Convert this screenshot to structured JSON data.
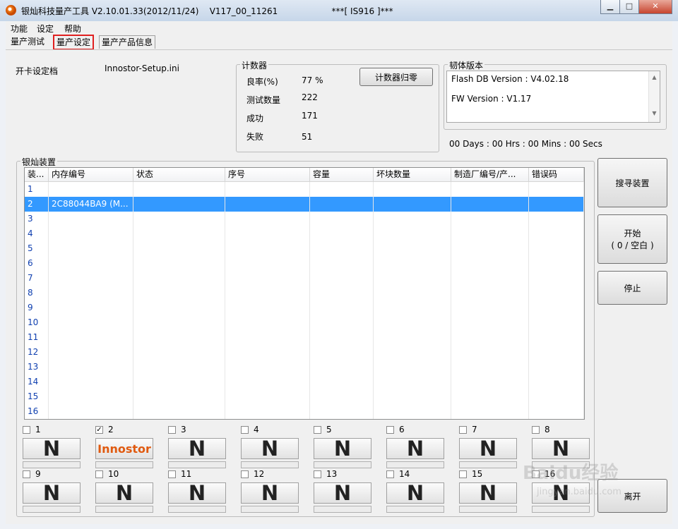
{
  "window": {
    "title": "银灿科技量产工具 V2.10.01.33(2012/11/24)    V117_00_11261                    ***[ IS916 ]***",
    "controls": {
      "minimize": "▁",
      "maximize": "□",
      "close": "✕"
    }
  },
  "menu": [
    "功能",
    "设定",
    "帮助"
  ],
  "tabs": [
    "量产测试",
    "量产设定",
    "量产产品信息"
  ],
  "settings": {
    "label": "开卡设定档",
    "value": "Innostor-Setup.ini"
  },
  "counter": {
    "title": "计数器",
    "reset_label": "计数器归零",
    "rows": [
      {
        "label": "良率(%)",
        "value": "77 %"
      },
      {
        "label": "测试数量",
        "value": "222"
      },
      {
        "label": "成功",
        "value": "171"
      },
      {
        "label": "失败",
        "value": "51"
      }
    ]
  },
  "firmware": {
    "title": "韧体版本",
    "flash_db": "Flash DB Version :  V4.02.18",
    "fw": "FW Version :   V1.17"
  },
  "timer": "00 Days : 00 Hrs : 00 Mins : 00 Secs",
  "devices": {
    "title": "银灿装置",
    "columns": [
      "装...",
      "内存编号",
      "状态",
      "序号",
      "容量",
      "坏块数量",
      "制造厂编号/产...",
      "错误码"
    ],
    "rows": [
      {
        "no": "1",
        "mem": ""
      },
      {
        "no": "2",
        "mem": "2C88044BA9 (M..."
      },
      {
        "no": "3",
        "mem": ""
      },
      {
        "no": "4",
        "mem": ""
      },
      {
        "no": "5",
        "mem": ""
      },
      {
        "no": "6",
        "mem": ""
      },
      {
        "no": "7",
        "mem": ""
      },
      {
        "no": "8",
        "mem": ""
      },
      {
        "no": "9",
        "mem": ""
      },
      {
        "no": "10",
        "mem": ""
      },
      {
        "no": "11",
        "mem": ""
      },
      {
        "no": "12",
        "mem": ""
      },
      {
        "no": "13",
        "mem": ""
      },
      {
        "no": "14",
        "mem": ""
      },
      {
        "no": "15",
        "mem": ""
      },
      {
        "no": "16",
        "mem": ""
      }
    ],
    "selected_row": 2
  },
  "slots": [
    {
      "num": "1",
      "checked": false,
      "label": "N"
    },
    {
      "num": "2",
      "checked": true,
      "label": "Innostor"
    },
    {
      "num": "3",
      "checked": false,
      "label": "N"
    },
    {
      "num": "4",
      "checked": false,
      "label": "N"
    },
    {
      "num": "5",
      "checked": false,
      "label": "N"
    },
    {
      "num": "6",
      "checked": false,
      "label": "N"
    },
    {
      "num": "7",
      "checked": false,
      "label": "N"
    },
    {
      "num": "8",
      "checked": false,
      "label": "N"
    },
    {
      "num": "9",
      "checked": false,
      "label": "N"
    },
    {
      "num": "10",
      "checked": false,
      "label": "N"
    },
    {
      "num": "11",
      "checked": false,
      "label": "N"
    },
    {
      "num": "12",
      "checked": false,
      "label": "N"
    },
    {
      "num": "13",
      "checked": false,
      "label": "N"
    },
    {
      "num": "14",
      "checked": false,
      "label": "N"
    },
    {
      "num": "15",
      "checked": false,
      "label": "N"
    },
    {
      "num": "16",
      "checked": false,
      "label": "N"
    }
  ],
  "actions": {
    "search": "搜寻装置",
    "start_line1": "开始",
    "start_line2": "( 0 / 空白 )",
    "stop": "停止",
    "exit": "离开"
  },
  "watermark": "Baidu经验",
  "watermark_url": "jingyan.baidu.com"
}
